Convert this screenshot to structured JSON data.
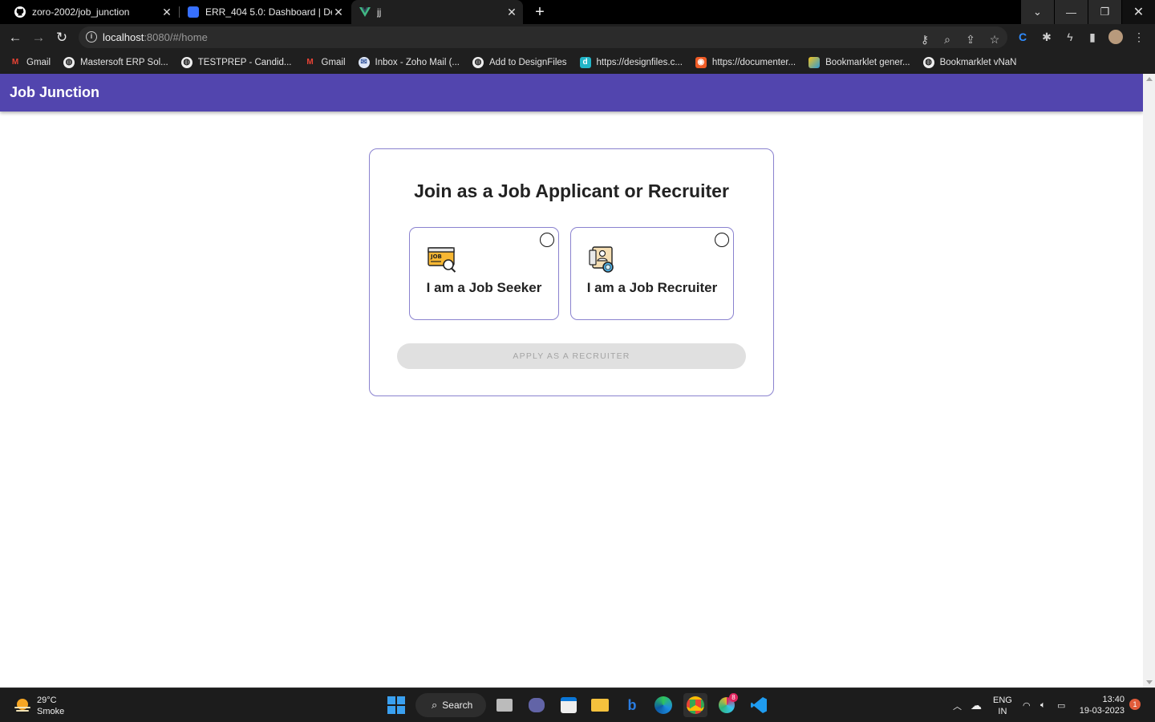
{
  "browser": {
    "tabs": [
      {
        "title": "zoro-2002/job_junction",
        "icon": "github-icon"
      },
      {
        "title": "ERR_404 5.0: Dashboard | Devfolio",
        "icon": "devfolio-icon"
      },
      {
        "title": "jj",
        "icon": "vue-icon",
        "active": true
      }
    ],
    "url_host": "localhost",
    "url_rest": ":8080/#/home",
    "bookmarks": [
      {
        "label": "Gmail",
        "icon": "gmail-icon"
      },
      {
        "label": "Mastersoft ERP Sol...",
        "icon": "globe-icon"
      },
      {
        "label": "TESTPREP - Candid...",
        "icon": "globe-icon"
      },
      {
        "label": "Gmail",
        "icon": "gmail-icon"
      },
      {
        "label": "Inbox - Zoho Mail (...",
        "icon": "zoho-icon"
      },
      {
        "label": "Add to DesignFiles",
        "icon": "globe-icon"
      },
      {
        "label": "https://designfiles.c...",
        "icon": "designfiles-icon"
      },
      {
        "label": "https://documenter...",
        "icon": "postman-icon"
      },
      {
        "label": "Bookmarklet gener...",
        "icon": "bookmarklet-icon"
      },
      {
        "label": "Bookmarklet vNaN",
        "icon": "globe-icon"
      }
    ]
  },
  "app": {
    "title": "Job Junction",
    "heading": "Join as a Job Applicant or Recruiter",
    "options": {
      "seeker": "I am a Job Seeker",
      "recruiter": "I am a Job Recruiter"
    },
    "apply_button": "APPLY AS A RECRUITER"
  },
  "taskbar": {
    "weather_temp": "29°C",
    "weather_desc": "Smoke",
    "search_label": "Search",
    "lang_top": "ENG",
    "lang_bottom": "IN",
    "time": "13:40",
    "date": "19-03-2023",
    "notification_count": "1",
    "slack_badge": "8"
  },
  "colors": {
    "appbar": "#5245ae",
    "card_border": "#8a82cf"
  }
}
